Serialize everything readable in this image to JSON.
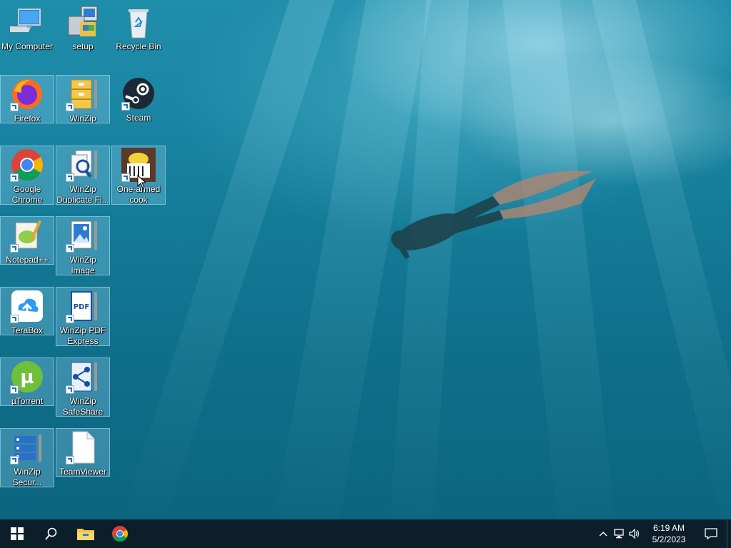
{
  "desktop": {
    "icons": [
      {
        "name": "My Computer"
      },
      {
        "name": "setup"
      },
      {
        "name": "Recycle Bin"
      },
      {
        "name": "Firefox"
      },
      {
        "name": "WinZip"
      },
      {
        "name": "Steam"
      },
      {
        "name": "Google Chrome"
      },
      {
        "name": "WinZip Duplicate Fi..."
      },
      {
        "name": "One-armed cook"
      },
      {
        "name": "Notepad++"
      },
      {
        "name": "WinZip Image Manager"
      },
      {
        "name": "TeraBox"
      },
      {
        "name": "WinZip PDF Express"
      },
      {
        "name": "µTorrent"
      },
      {
        "name": "WinZip SafeShare"
      },
      {
        "name": "WinZip Secur..."
      },
      {
        "name": "TeamViewer"
      }
    ]
  },
  "taskbar": {
    "icons": [
      "windows-start-icon",
      "search-icon",
      "file-explorer-icon",
      "chrome-icon"
    ],
    "tray": {
      "icons": [
        "chevron-up-icon",
        "network-icon",
        "volume-icon"
      ]
    },
    "clock": {
      "time": "6:19 AM",
      "date": "5/2/2023"
    }
  },
  "colors": {
    "taskbar": "#0b1e2a",
    "selection": "#78bedc",
    "water": "#137a96"
  }
}
